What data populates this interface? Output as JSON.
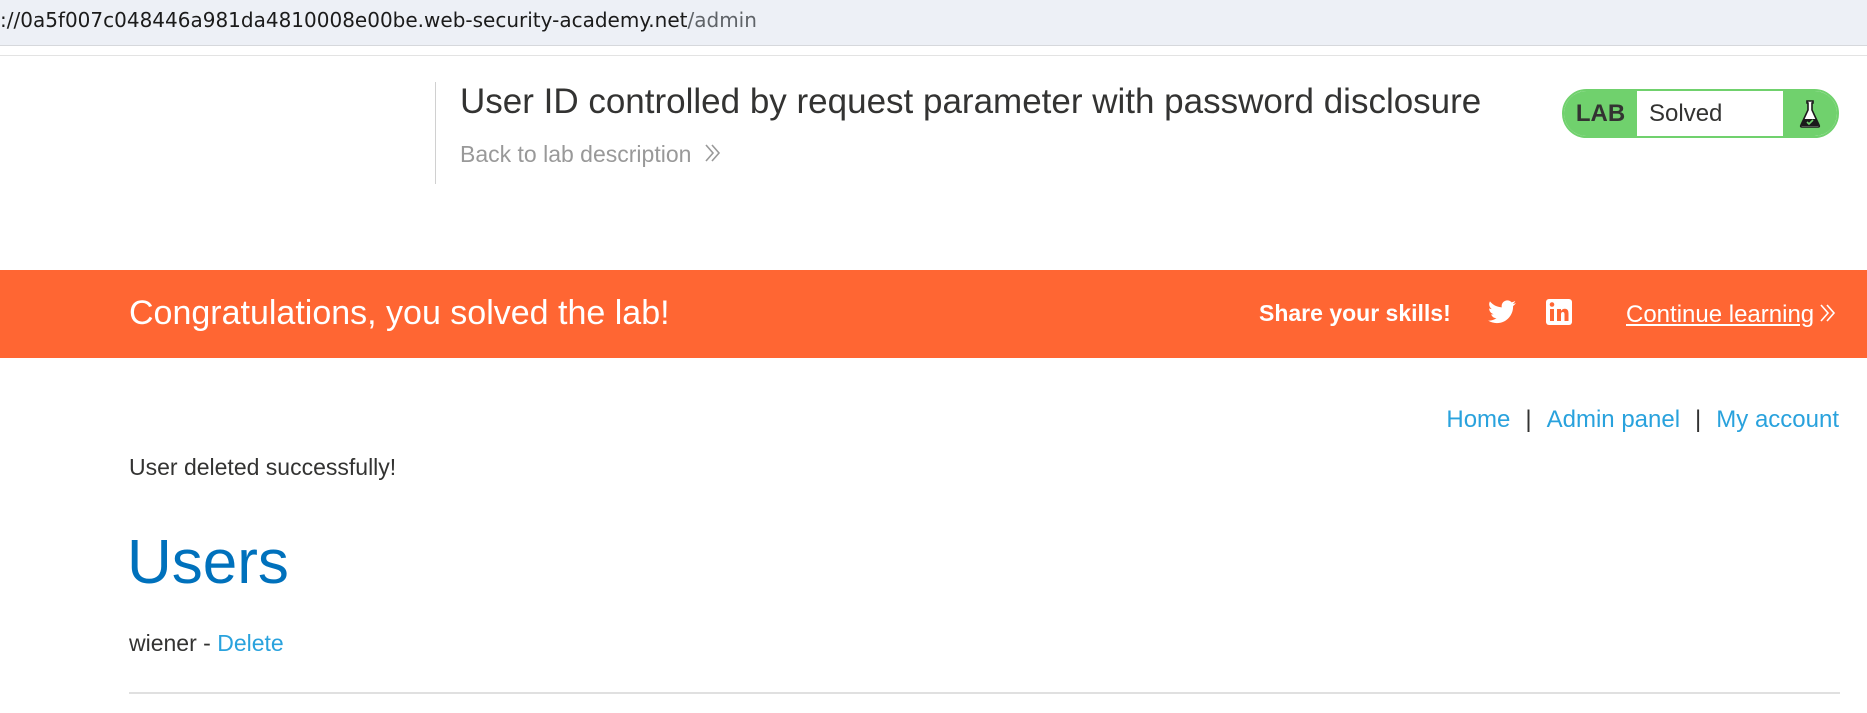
{
  "browser": {
    "url_host": "://0a5f007c048446a981da4810008e00be.web-security-academy.net",
    "url_path": "/admin"
  },
  "header": {
    "lab_title": "User ID controlled by request parameter with password disclosure",
    "back_link": "Back to lab description",
    "status_widget": {
      "label": "LAB",
      "status": "Solved",
      "icon": "flask-icon",
      "color": "#70d16d"
    }
  },
  "banner": {
    "message": "Congratulations, you solved the lab!",
    "share_label": "Share your skills!",
    "social_icons": [
      "twitter-icon",
      "linkedin-icon"
    ],
    "continue_label": "Continue learning",
    "color": "#ff6633"
  },
  "nav": {
    "items": [
      {
        "label": "Home"
      },
      {
        "label": "Admin panel"
      },
      {
        "label": "My account"
      }
    ],
    "separator": "|"
  },
  "content": {
    "message": "User deleted successfully!",
    "heading": "Users",
    "users": [
      {
        "name": "wiener",
        "separator": "-",
        "action": "Delete"
      }
    ]
  },
  "colors": {
    "link": "#29a2dd",
    "heading": "#0071bc",
    "text": "#333332"
  }
}
